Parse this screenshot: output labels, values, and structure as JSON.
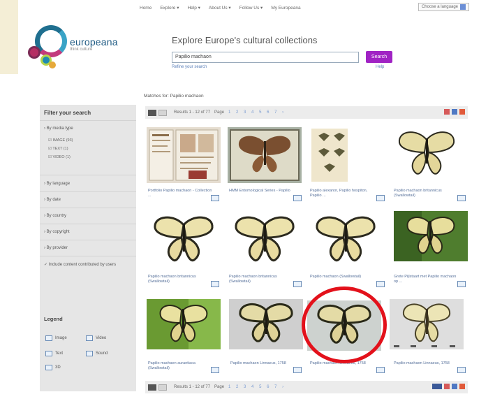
{
  "top_nav": {
    "items": [
      "Home",
      "Explore ▾",
      "Help ▾",
      "About Us ▾",
      "Follow Us ▾",
      "My Europeana"
    ],
    "language": "Choose a language"
  },
  "logo": {
    "wordmark": "europeana",
    "tagline": "think culture"
  },
  "search": {
    "title": "Explore Europe's cultural collections",
    "query": "Papilio machaon",
    "button": "Search",
    "refine": "Refine your search",
    "help": "Help"
  },
  "matches_text": "Matches for: Papilio machaon",
  "sidebar": {
    "title": "Filter your search",
    "facets": [
      "By media type",
      "By language",
      "By date",
      "By country",
      "By copyright",
      "By provider"
    ],
    "media_sub": [
      "IMAGE (93)",
      "TEXT (1)",
      "VIDEO (1)"
    ],
    "checkbox_label": "Include content contributed by users",
    "legend_title": "Legend",
    "legend": [
      "Image",
      "Video",
      "Text",
      "Sound",
      "3D"
    ]
  },
  "toolbar": {
    "results": "Results 1 - 12 of 77",
    "page": "Page",
    "pages": "1 2 3 4 5 6 7 ›"
  },
  "results": [
    {
      "caption": "Portfolio Papilio machaon - Collection ..."
    },
    {
      "caption": "HMM Entomological Series - Papilio"
    },
    {
      "caption": "Papilio alexanor, Papilio hospiton, Papilio ..."
    },
    {
      "caption": "Papilio machaon britannicus (Swallowtail)"
    },
    {
      "caption": "Papilio machaon britannicus (Swallowtail)"
    },
    {
      "caption": "Papilio machaon britannicus (Swallowtail)"
    },
    {
      "caption": "Papilio machaon (Swallowtail)"
    },
    {
      "caption": "Grote Pijlstaart met Papilio machaon op ..."
    },
    {
      "caption": "Papilio machaon aurantiaca (Swallowtail)"
    },
    {
      "caption": "Papilio machaon Linnaeus, 1758"
    },
    {
      "caption": "Papilio machaon Linnaeus, 1758"
    },
    {
      "caption": "Papilio machaon Linnaeus, 1758"
    }
  ],
  "colors": {
    "search_button": "#a023c4",
    "highlight": "#e3111b",
    "link": "#56709a"
  }
}
